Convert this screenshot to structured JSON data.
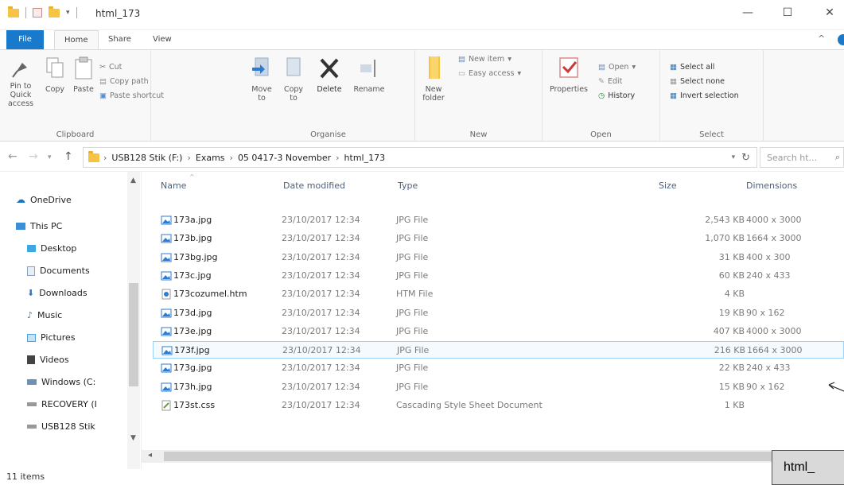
{
  "window": {
    "title": "html_173",
    "minimize": "—",
    "maximize": "☐",
    "close": "✕"
  },
  "ribbon_tabs": [
    {
      "label": "File"
    },
    {
      "label": "Home"
    },
    {
      "label": "Share"
    },
    {
      "label": "View"
    }
  ],
  "ribbon": {
    "clipboard": {
      "label": "Clipboard",
      "pin": "Pin to Quick access",
      "copy": "Copy",
      "paste": "Paste",
      "cut": "Cut",
      "copy_path": "Copy path",
      "paste_shortcut": "Paste shortcut"
    },
    "organise": {
      "label": "Organise",
      "move_to": "Move to",
      "copy_to": "Copy to",
      "delete": "Delete",
      "rename": "Rename"
    },
    "new": {
      "label": "New",
      "new_folder": "New folder",
      "new_item": "New item",
      "easy_access": "Easy access"
    },
    "open": {
      "label": "Open",
      "properties": "Properties",
      "open": "Open",
      "edit": "Edit",
      "history": "History"
    },
    "select": {
      "label": "Select",
      "select_all": "Select all",
      "select_none": "Select none",
      "invert_selection": "Invert selection"
    }
  },
  "address": {
    "crumbs": [
      "USB128 Stik (F:)",
      "Exams",
      "05 0417-3 November",
      "html_173"
    ],
    "search_placeholder": "Search ht..."
  },
  "nav_pane": [
    {
      "label": "OneDrive",
      "icon": "onedrive-icon",
      "color": "#1e73be"
    },
    {
      "label": "This PC",
      "icon": "this-pc-icon",
      "color": "#3a8fd8"
    },
    {
      "label": "Desktop",
      "icon": "desktop-icon",
      "color": "#3fa7e0"
    },
    {
      "label": "Documents",
      "icon": "documents-icon",
      "color": "#8aa3b8"
    },
    {
      "label": "Downloads",
      "icon": "downloads-icon",
      "color": "#2b7bd1"
    },
    {
      "label": "Music",
      "icon": "music-icon",
      "color": "#2b7bd1"
    },
    {
      "label": "Pictures",
      "icon": "pictures-icon",
      "color": "#5aa0d6"
    },
    {
      "label": "Videos",
      "icon": "videos-icon",
      "color": "#555555"
    },
    {
      "label": "Windows (C:",
      "icon": "drive-icon",
      "color": "#6b8fb5"
    },
    {
      "label": "RECOVERY (I",
      "icon": "drive-icon",
      "color": "#888888"
    },
    {
      "label": "USB128 Stik",
      "icon": "usb-drive-icon",
      "color": "#888888"
    }
  ],
  "columns": {
    "name": "Name",
    "date": "Date modified",
    "type": "Type",
    "size": "Size",
    "dimensions": "Dimensions"
  },
  "files": [
    {
      "name": "173a.jpg",
      "date": "23/10/2017 12:34",
      "type": "JPG File",
      "size": "2,543 KB",
      "dimensions": "4000 x 3000",
      "icon": "jpg-icon"
    },
    {
      "name": "173b.jpg",
      "date": "23/10/2017 12:34",
      "type": "JPG File",
      "size": "1,070 KB",
      "dimensions": "1664 x 3000",
      "icon": "jpg-icon"
    },
    {
      "name": "173bg.jpg",
      "date": "23/10/2017 12:34",
      "type": "JPG File",
      "size": "31 KB",
      "dimensions": "400 x 300",
      "icon": "jpg-icon"
    },
    {
      "name": "173c.jpg",
      "date": "23/10/2017 12:34",
      "type": "JPG File",
      "size": "60 KB",
      "dimensions": "240 x 433",
      "icon": "jpg-icon"
    },
    {
      "name": "173cozumel.htm",
      "date": "23/10/2017 12:34",
      "type": "HTM File",
      "size": "4 KB",
      "dimensions": "",
      "icon": "htm-icon"
    },
    {
      "name": "173d.jpg",
      "date": "23/10/2017 12:34",
      "type": "JPG File",
      "size": "19 KB",
      "dimensions": "90 x 162",
      "icon": "jpg-icon"
    },
    {
      "name": "173e.jpg",
      "date": "23/10/2017 12:34",
      "type": "JPG File",
      "size": "407 KB",
      "dimensions": "4000 x 3000",
      "icon": "jpg-icon"
    },
    {
      "name": "173f.jpg",
      "date": "23/10/2017 12:34",
      "type": "JPG File",
      "size": "216 KB",
      "dimensions": "1664 x 3000",
      "icon": "jpg-icon",
      "selected": true
    },
    {
      "name": "173g.jpg",
      "date": "23/10/2017 12:34",
      "type": "JPG File",
      "size": "22 KB",
      "dimensions": "240 x 433",
      "icon": "jpg-icon"
    },
    {
      "name": "173h.jpg",
      "date": "23/10/2017 12:34",
      "type": "JPG File",
      "size": "15 KB",
      "dimensions": "90 x 162",
      "icon": "jpg-icon"
    },
    {
      "name": "173st.css",
      "date": "23/10/2017 12:34",
      "type": "Cascading Style Sheet Document",
      "size": "1 KB",
      "dimensions": "",
      "icon": "css-icon"
    }
  ],
  "status": {
    "items": "11 items"
  },
  "callout": {
    "text": "html_"
  },
  "colors": {
    "accent": "#1979ca",
    "selection_border": "#99d1ff",
    "header_text": "#4c607a"
  }
}
